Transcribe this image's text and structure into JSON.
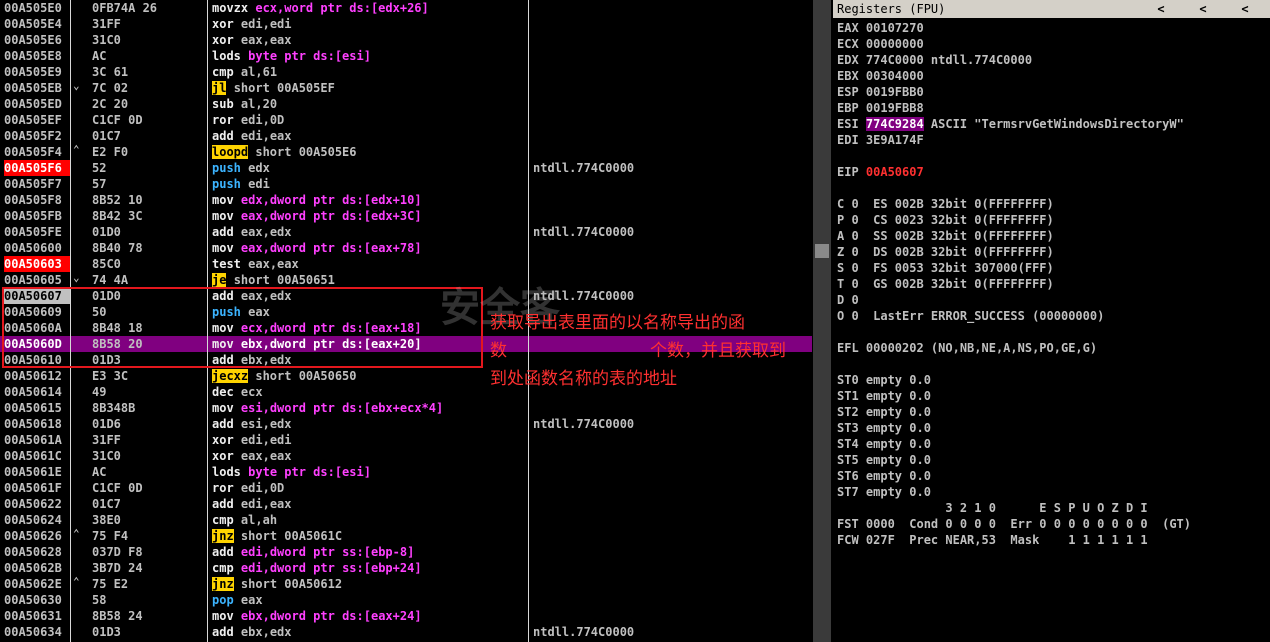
{
  "disasm": [
    {
      "addr": "00A505E0",
      "mark": "",
      "hex": "0FB74A 26",
      "op": "movzx",
      "opcls": "white",
      "args": "ecx,word ptr ds:[edx+26]",
      "comment": ""
    },
    {
      "addr": "00A505E4",
      "mark": "",
      "hex": "31FF",
      "op": "xor",
      "opcls": "white",
      "args": "edi,edi",
      "comment": ""
    },
    {
      "addr": "00A505E6",
      "mark": "",
      "hex": "31C0",
      "op": "xor",
      "opcls": "white",
      "args": "eax,eax",
      "comment": ""
    },
    {
      "addr": "00A505E8",
      "mark": "",
      "hex": "AC",
      "op": "lods",
      "opcls": "white",
      "args": "byte ptr ds:[esi]",
      "comment": ""
    },
    {
      "addr": "00A505E9",
      "mark": "",
      "hex": "3C 61",
      "op": "cmp",
      "opcls": "white",
      "args": "al,61",
      "comment": ""
    },
    {
      "addr": "00A505EB",
      "mark": "v",
      "hex": "7C 02",
      "op": "jl",
      "opcls": "yel",
      "args": "short 00A505EF",
      "comment": ""
    },
    {
      "addr": "00A505ED",
      "mark": "",
      "hex": "2C 20",
      "op": "sub",
      "opcls": "white",
      "args": "al,20",
      "comment": ""
    },
    {
      "addr": "00A505EF",
      "mark": "",
      "hex": "C1CF 0D",
      "op": "ror",
      "opcls": "white",
      "args": "edi,0D",
      "comment": ""
    },
    {
      "addr": "00A505F2",
      "mark": "",
      "hex": "01C7",
      "op": "add",
      "opcls": "white",
      "args": "edi,eax",
      "comment": ""
    },
    {
      "addr": "00A505F4",
      "mark": "^",
      "hex": "E2 F0",
      "op": "loopd",
      "opcls": "yel",
      "args": "short 00A505E6",
      "comment": ""
    },
    {
      "addr": "00A505F6",
      "mark": "",
      "hex": "52",
      "op": "push",
      "opcls": "blue",
      "args": "edx",
      "comment": "ntdll.774C0000",
      "red": true
    },
    {
      "addr": "00A505F7",
      "mark": "",
      "hex": "57",
      "op": "push",
      "opcls": "blue",
      "args": "edi",
      "comment": ""
    },
    {
      "addr": "00A505F8",
      "mark": "",
      "hex": "8B52 10",
      "op": "mov",
      "opcls": "white",
      "args": "edx,dword ptr ds:[edx+10]",
      "comment": ""
    },
    {
      "addr": "00A505FB",
      "mark": "",
      "hex": "8B42 3C",
      "op": "mov",
      "opcls": "white",
      "args": "eax,dword ptr ds:[edx+3C]",
      "comment": ""
    },
    {
      "addr": "00A505FE",
      "mark": "",
      "hex": "01D0",
      "op": "add",
      "opcls": "white",
      "args": "eax,edx",
      "comment": "ntdll.774C0000"
    },
    {
      "addr": "00A50600",
      "mark": "",
      "hex": "8B40 78",
      "op": "mov",
      "opcls": "white",
      "args": "eax,dword ptr ds:[eax+78]",
      "comment": ""
    },
    {
      "addr": "00A50603",
      "mark": "",
      "hex": "85C0",
      "op": "test",
      "opcls": "white",
      "args": "eax,eax",
      "comment": "",
      "red": true
    },
    {
      "addr": "00A50605",
      "mark": "v",
      "hex": "74 4A",
      "op": "je",
      "opcls": "yel",
      "args": "short 00A50651",
      "comment": ""
    },
    {
      "addr": "00A50607",
      "mark": "",
      "hex": "01D0",
      "op": "add",
      "opcls": "white",
      "args": "eax,edx",
      "comment": "ntdll.774C0000",
      "sel": true
    },
    {
      "addr": "00A50609",
      "mark": "",
      "hex": "50",
      "op": "push",
      "opcls": "blue",
      "args": "eax",
      "comment": ""
    },
    {
      "addr": "00A5060A",
      "mark": "",
      "hex": "8B48 18",
      "op": "mov",
      "opcls": "white",
      "args": "ecx,dword ptr ds:[eax+18]",
      "comment": ""
    },
    {
      "addr": "00A5060D",
      "mark": "",
      "hex": "8B58 20",
      "op": "mov",
      "opcls": "white",
      "args": "ebx,dword ptr ds:[eax+20]",
      "comment": "",
      "hl": true
    },
    {
      "addr": "00A50610",
      "mark": "",
      "hex": "01D3",
      "op": "add",
      "opcls": "white",
      "args": "ebx,edx",
      "comment": ""
    },
    {
      "addr": "00A50612",
      "mark": "",
      "hex": "E3 3C",
      "op": "jecxz",
      "opcls": "yel",
      "args": "short 00A50650",
      "comment": ""
    },
    {
      "addr": "00A50614",
      "mark": "",
      "hex": "49",
      "op": "dec",
      "opcls": "white",
      "args": "ecx",
      "comment": ""
    },
    {
      "addr": "00A50615",
      "mark": "",
      "hex": "8B348B",
      "op": "mov",
      "opcls": "white",
      "args": "esi,dword ptr ds:[ebx+ecx*4]",
      "comment": ""
    },
    {
      "addr": "00A50618",
      "mark": "",
      "hex": "01D6",
      "op": "add",
      "opcls": "white",
      "args": "esi,edx",
      "comment": "ntdll.774C0000"
    },
    {
      "addr": "00A5061A",
      "mark": "",
      "hex": "31FF",
      "op": "xor",
      "opcls": "white",
      "args": "edi,edi",
      "comment": ""
    },
    {
      "addr": "00A5061C",
      "mark": "",
      "hex": "31C0",
      "op": "xor",
      "opcls": "white",
      "args": "eax,eax",
      "comment": ""
    },
    {
      "addr": "00A5061E",
      "mark": "",
      "hex": "AC",
      "op": "lods",
      "opcls": "white",
      "args": "byte ptr ds:[esi]",
      "comment": ""
    },
    {
      "addr": "00A5061F",
      "mark": "",
      "hex": "C1CF 0D",
      "op": "ror",
      "opcls": "white",
      "args": "edi,0D",
      "comment": ""
    },
    {
      "addr": "00A50622",
      "mark": "",
      "hex": "01C7",
      "op": "add",
      "opcls": "white",
      "args": "edi,eax",
      "comment": ""
    },
    {
      "addr": "00A50624",
      "mark": "",
      "hex": "38E0",
      "op": "cmp",
      "opcls": "white",
      "args": "al,ah",
      "comment": ""
    },
    {
      "addr": "00A50626",
      "mark": "^",
      "hex": "75 F4",
      "op": "jnz",
      "opcls": "yel",
      "args": "short 00A5061C",
      "comment": ""
    },
    {
      "addr": "00A50628",
      "mark": "",
      "hex": "037D F8",
      "op": "add",
      "opcls": "white",
      "args": "edi,dword ptr ss:[ebp-8]",
      "comment": ""
    },
    {
      "addr": "00A5062B",
      "mark": "",
      "hex": "3B7D 24",
      "op": "cmp",
      "opcls": "white",
      "args": "edi,dword ptr ss:[ebp+24]",
      "comment": ""
    },
    {
      "addr": "00A5062E",
      "mark": "^",
      "hex": "75 E2",
      "op": "jnz",
      "opcls": "yel",
      "args": "short 00A50612",
      "comment": ""
    },
    {
      "addr": "00A50630",
      "mark": "",
      "hex": "58",
      "op": "pop",
      "opcls": "blue",
      "args": "eax",
      "comment": ""
    },
    {
      "addr": "00A50631",
      "mark": "",
      "hex": "8B58 24",
      "op": "mov",
      "opcls": "white",
      "args": "ebx,dword ptr ds:[eax+24]",
      "comment": ""
    },
    {
      "addr": "00A50634",
      "mark": "",
      "hex": "01D3",
      "op": "add",
      "opcls": "white",
      "args": "ebx,edx",
      "comment": "ntdll.774C0000"
    }
  ],
  "registers_panel": {
    "title": "Registers (FPU)",
    "arrows": [
      "<",
      "<",
      "<"
    ],
    "lines": [
      {
        "t": "EAX 00107270"
      },
      {
        "t": "ECX 00000000"
      },
      {
        "t": "EDX 774C0000 ntdll.774C0000"
      },
      {
        "t": "EBX 00304000"
      },
      {
        "t": "ESP 0019FBB0"
      },
      {
        "t": "EBP 0019FBB8"
      },
      {
        "pre": "ESI ",
        "hl": "774C9284",
        "post": " ASCII \"TermsrvGetWindowsDirectoryW\""
      },
      {
        "t": "EDI 3E9A174F"
      },
      {
        "t": ""
      },
      {
        "pre": "EIP ",
        "red": "00A50607",
        "post": ""
      },
      {
        "t": ""
      },
      {
        "t": "C 0  ES 002B 32bit 0(FFFFFFFF)"
      },
      {
        "t": "P 0  CS 0023 32bit 0(FFFFFFFF)"
      },
      {
        "t": "A 0  SS 002B 32bit 0(FFFFFFFF)"
      },
      {
        "t": "Z 0  DS 002B 32bit 0(FFFFFFFF)"
      },
      {
        "t": "S 0  FS 0053 32bit 307000(FFF)"
      },
      {
        "t": "T 0  GS 002B 32bit 0(FFFFFFFF)"
      },
      {
        "t": "D 0"
      },
      {
        "t": "O 0  LastErr ERROR_SUCCESS (00000000)"
      },
      {
        "t": ""
      },
      {
        "t": "EFL 00000202 (NO,NB,NE,A,NS,PO,GE,G)"
      },
      {
        "t": ""
      },
      {
        "t": "ST0 empty 0.0"
      },
      {
        "t": "ST1 empty 0.0"
      },
      {
        "t": "ST2 empty 0.0"
      },
      {
        "t": "ST3 empty 0.0"
      },
      {
        "t": "ST4 empty 0.0"
      },
      {
        "t": "ST5 empty 0.0"
      },
      {
        "t": "ST6 empty 0.0"
      },
      {
        "t": "ST7 empty 0.0"
      },
      {
        "t": "               3 2 1 0      E S P U O Z D I"
      },
      {
        "t": "FST 0000  Cond 0 0 0 0  Err 0 0 0 0 0 0 0 0  (GT)"
      },
      {
        "t": "FCW 027F  Prec NEAR,53  Mask    1 1 1 1 1 1"
      }
    ]
  },
  "annotation": {
    "line1": "获取导出表里面的以名称导出的函",
    "line2a": "数",
    "line2b": "个数，并且获取到",
    "line3": "到处函数名称的表的地址"
  },
  "watermark": "安全客"
}
